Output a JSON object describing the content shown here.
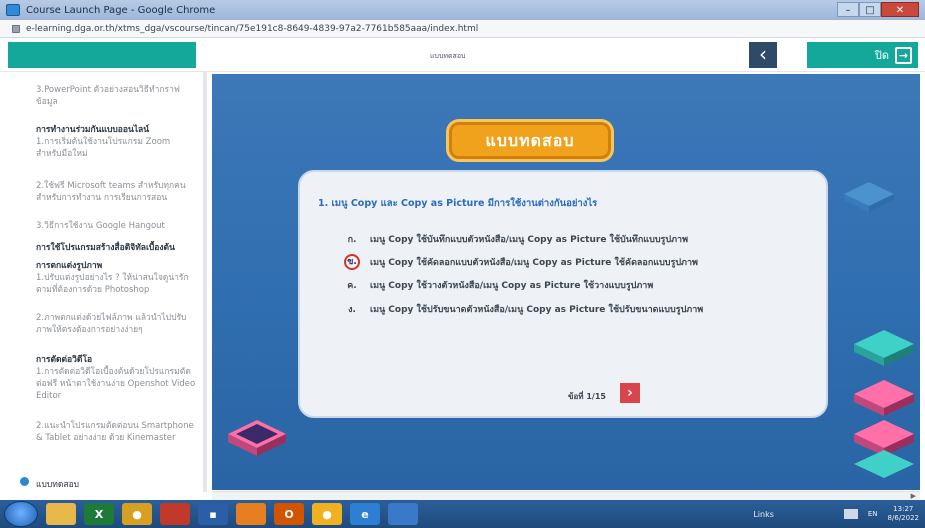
{
  "browser": {
    "window_title": "Course Launch Page - Google Chrome",
    "url": "e-learning.dga.or.th/xtms_dga/vscourse/tincan/75e191c8-8649-4839-97a2-7761b585aaa/index.html",
    "controls": [
      "–",
      "□",
      "✕"
    ]
  },
  "header": {
    "center_label": "แบบทดสอบ",
    "back_icon": "‹",
    "exit_label": "ปิด",
    "exit_icon": "→"
  },
  "sidebar": {
    "items": [
      {
        "text": "3.PowerPoint ตัวอย่างสอนวิธีทำกราฟข้อมูล",
        "heading": false
      },
      {
        "text": "การทำงานร่วมกันแบบออนไลน์",
        "heading": true
      },
      {
        "text": "1.การเริ่มต้นใช้งานโปรแกรม Zoom สำหรับมือใหม่",
        "heading": false
      },
      {
        "text": "2.ใช้ฟรี Microsoft teams สำหรับทุกคน สำหรับการทำงาน การเรียนการสอน",
        "heading": false
      },
      {
        "text": "3.วิธีการใช้งาน Google Hangout",
        "heading": false
      },
      {
        "text": "การใช้โปรแกรมสร้างสื่อดิจิทัลเบื้องต้น",
        "heading": true
      },
      {
        "text": "การตกแต่งรูปภาพ",
        "heading": true
      },
      {
        "text": "1.ปรับแต่งรูปอย่างไร ? ให้น่าสนใจดูน่ารักตามที่ต้องการด้วย Photoshop",
        "heading": false
      },
      {
        "text": "2.ภาพตกแต่งด้วยไฟล์ภาพ แล้วนำไปปรับภาพให้ตรงต้องการอย่างง่ายๆ",
        "heading": false
      },
      {
        "text": "การตัดต่อวิดีโอ",
        "heading": true
      },
      {
        "text": "1.การตัดต่อวิดีโอเบื้องต้นด้วยโปรแกรมตัดต่อฟรี หน้าตาใช้งานง่าย Openshot Video Editor",
        "heading": false
      },
      {
        "text": "2.แนะนำโปรแกรมตัดต่อบน Smartphone & Tablet อย่างง่าย ด้วย Kinemaster",
        "heading": false
      }
    ],
    "current": "แบบทดสอบ"
  },
  "quiz": {
    "title": "แบบทดสอบ",
    "question": "1. เมนู Copy และ Copy as Picture มีการใช้งานต่างกันอย่างไร",
    "options": [
      {
        "key": "ก.",
        "text": "เมนู Copy ใช้บันทึกแบบตัวหนังสือ/เมนู Copy as Picture ใช้บันทึกแบบรูปภาพ",
        "selected": false
      },
      {
        "key": "ข.",
        "text": "เมนู Copy ใช้คัดลอกแบบตัวหนังสือ/เมนู Copy as Picture ใช้คัดลอกแบบรูปภาพ",
        "selected": true
      },
      {
        "key": "ค.",
        "text": "เมนู Copy ใช้วางตัวหนังสือ/เมนู Copy as Picture ใช้วางแบบรูปภาพ",
        "selected": false
      },
      {
        "key": "ง.",
        "text": "เมนู Copy ใช้ปรับขนาดตัวหนังสือ/เมนู Copy as Picture ใช้ปรับขนาดแบบรูปภาพ",
        "selected": false
      }
    ],
    "pager": "ข้อที่ 1/15",
    "next_icon": "›"
  },
  "taskbar": {
    "apps": [
      {
        "label": "",
        "color": "#e8b84a"
      },
      {
        "label": "X",
        "color": "#1f7a3a"
      },
      {
        "label": "●",
        "color": "#d8a020"
      },
      {
        "label": "",
        "color": "#c0392b"
      },
      {
        "label": "▪",
        "color": "#2a5fa8"
      },
      {
        "label": "",
        "color": "#e67e22"
      },
      {
        "label": "O",
        "color": "#d35400"
      },
      {
        "label": "●",
        "color": "#f0b020"
      },
      {
        "label": "e",
        "color": "#2d7fd3"
      },
      {
        "label": "",
        "color": "#3a78c8"
      }
    ],
    "links": "Links",
    "lang": "EN",
    "time": "13:27",
    "date": "8/6/2022"
  }
}
